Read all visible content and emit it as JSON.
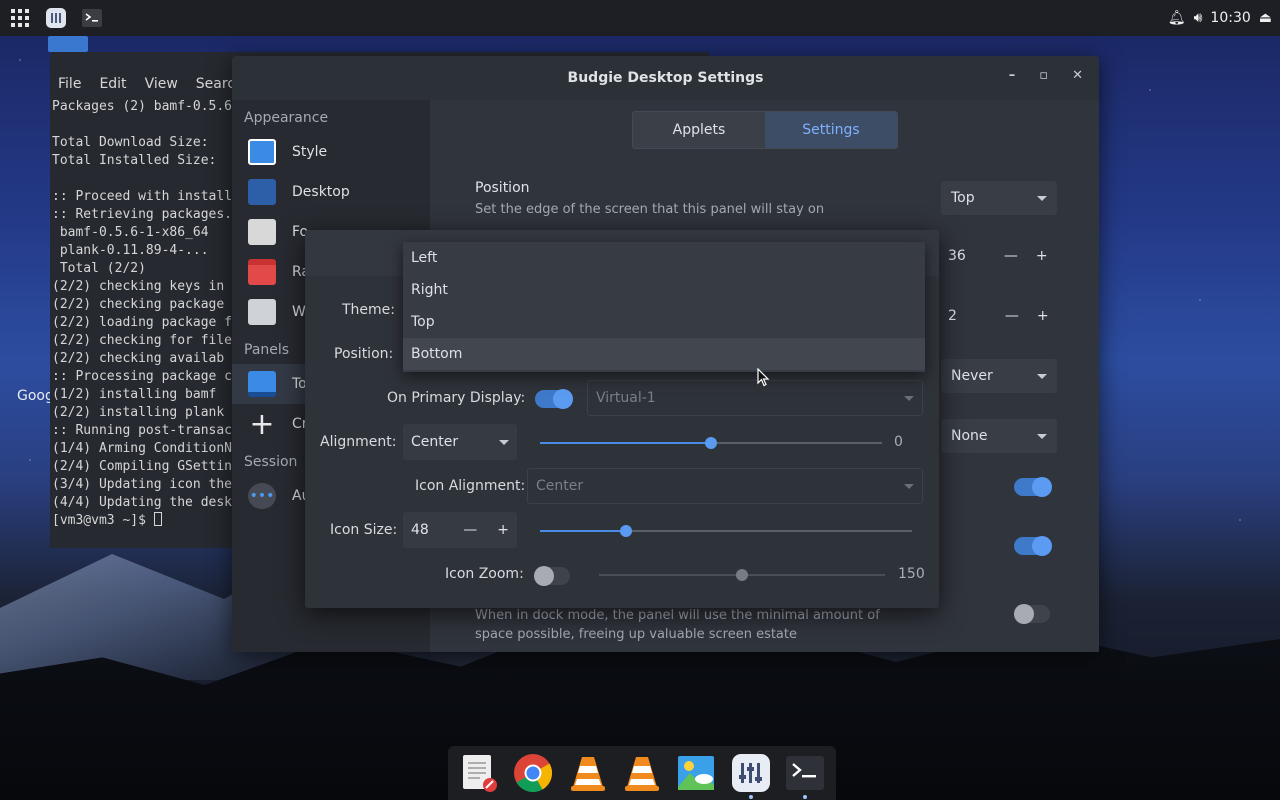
{
  "topbar": {
    "time": "10:30"
  },
  "terminal": {
    "menu": [
      "File",
      "Edit",
      "View",
      "Search"
    ],
    "lines": [
      "Packages (2) bamf-0.5.6",
      "",
      "Total Download Size:",
      "Total Installed Size:",
      "",
      ":: Proceed with install",
      ":: Retrieving packages.",
      " bamf-0.5.6-1-x86_64",
      " plank-0.11.89-4-...",
      " Total (2/2)",
      "(2/2) checking keys in",
      "(2/2) checking package",
      "(2/2) loading package f",
      "(2/2) checking for file",
      "(2/2) checking availab",
      ":: Processing package c",
      "(1/2) installing bamf",
      "(2/2) installing plank",
      ":: Running post-transac",
      "(1/4) Arming ConditionN",
      "(2/4) Compiling GSettin",
      "(3/4) Updating icon the",
      "(4/4) Updating the desk",
      "[vm3@vm3 ~]$ "
    ]
  },
  "desktop": {
    "google_label": "Goog"
  },
  "settings": {
    "title": "Budgie Desktop Settings",
    "sidebar": {
      "appearance_head": "Appearance",
      "panels_head": "Panels",
      "session_head": "Session",
      "items": [
        "Style",
        "Desktop",
        "Fo",
        "Ra",
        "W",
        "To",
        "Cr",
        "Au"
      ]
    },
    "tabs": {
      "applets": "Applets",
      "settings": "Settings"
    },
    "position": {
      "title": "Position",
      "desc": "Set the edge of the screen that this panel will stay on",
      "value": "Top"
    },
    "size_value": "36",
    "spacing_value": "2",
    "autohide_value": "Never",
    "shadow_value": "None",
    "dock_desc": "When in dock mode, the panel will use the minimal amount of space possible, freeing up valuable screen estate"
  },
  "dialog": {
    "theme_label": "Theme:",
    "position_label": "Position:",
    "primary_label": "On Primary Display:",
    "primary_value": "Virtual-1",
    "alignment_label": "Alignment:",
    "alignment_value": "Center",
    "offset_value": "0",
    "offset_fraction": 0.5,
    "icon_alignment_label": "Icon Alignment:",
    "icon_alignment_value": "Center",
    "icon_size_label": "Icon Size:",
    "icon_size_value": "48",
    "icon_size_fraction": 0.23,
    "icon_zoom_label": "Icon Zoom:",
    "icon_zoom_value": "150",
    "icon_zoom_fraction": 0.5
  },
  "dropdown": {
    "options": [
      "Left",
      "Right",
      "Top",
      "Bottom"
    ],
    "selected": "Bottom"
  },
  "colors": {
    "accent": "#4a8be6",
    "window_bg": "#2c3037"
  }
}
